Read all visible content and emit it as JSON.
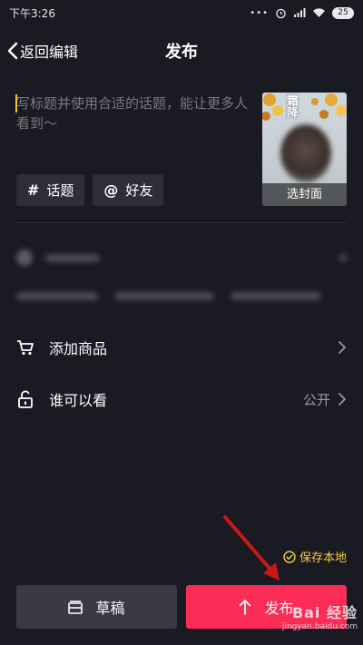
{
  "status_bar": {
    "time": "下午3:26",
    "battery": "25"
  },
  "header": {
    "back_label": "返回编辑",
    "title": "发布"
  },
  "caption": {
    "placeholder": "写标题并使用合适的话题，能让更多人看到～"
  },
  "cover": {
    "label": "选封面",
    "overlay_text": "霜降"
  },
  "chips": [
    {
      "symbol": "#",
      "label": "话题"
    },
    {
      "symbol": "@",
      "label": "好友"
    }
  ],
  "rows": {
    "add_product": {
      "label": "添加商品"
    },
    "visibility": {
      "label": "谁可以看",
      "value": "公开"
    }
  },
  "save_local": {
    "label": "保存本地"
  },
  "buttons": {
    "draft": "草稿",
    "publish": "发布"
  },
  "watermark": {
    "logo": "Bai 经验",
    "url": "jingyan.baidu.com"
  },
  "colors": {
    "accent": "#fb2c55",
    "save_local": "#f3cc3c",
    "background": "#1a1a22"
  }
}
